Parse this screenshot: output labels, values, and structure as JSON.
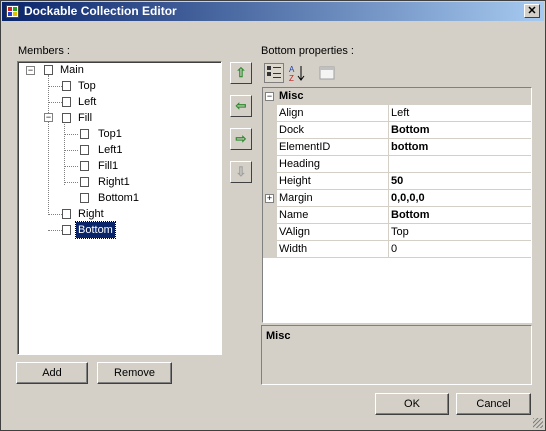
{
  "window": {
    "title": "Dockable Collection Editor",
    "close_glyph": "✕"
  },
  "members": {
    "label": "Members :",
    "tree": [
      {
        "label": "Main",
        "expanded": true
      },
      {
        "label": "Top"
      },
      {
        "label": "Left"
      },
      {
        "label": "Fill",
        "expanded": true
      },
      {
        "label": "Top1"
      },
      {
        "label": "Left1"
      },
      {
        "label": "Fill1"
      },
      {
        "label": "Right1"
      },
      {
        "label": "Bottom1"
      },
      {
        "label": "Right"
      },
      {
        "label": "Bottom",
        "selected": true
      }
    ],
    "add_label": "Add",
    "remove_label": "Remove"
  },
  "move_buttons": {
    "up_icon": "arrow-up-icon",
    "left_icon": "arrow-left-icon",
    "right_icon": "arrow-right-icon",
    "down_icon": "arrow-down-icon"
  },
  "properties": {
    "label": "Bottom properties :",
    "category": "Misc",
    "expand_glyph": "⊟",
    "rows": [
      {
        "name": "Align",
        "value": "Left",
        "bold": false
      },
      {
        "name": "Dock",
        "value": "Bottom",
        "bold": true
      },
      {
        "name": "ElementID",
        "value": "bottom",
        "bold": true
      },
      {
        "name": "Heading",
        "value": "",
        "bold": false
      },
      {
        "name": "Height",
        "value": "50",
        "bold": true
      },
      {
        "name": "Margin",
        "value": "0,0,0,0",
        "bold": true,
        "expandable": true
      },
      {
        "name": "Name",
        "value": "Bottom",
        "bold": true
      },
      {
        "name": "VAlign",
        "value": "Top",
        "bold": false
      },
      {
        "name": "Width",
        "value": "0",
        "bold": false
      }
    ],
    "description_title": "Misc"
  },
  "dialog": {
    "ok_label": "OK",
    "cancel_label": "Cancel"
  }
}
